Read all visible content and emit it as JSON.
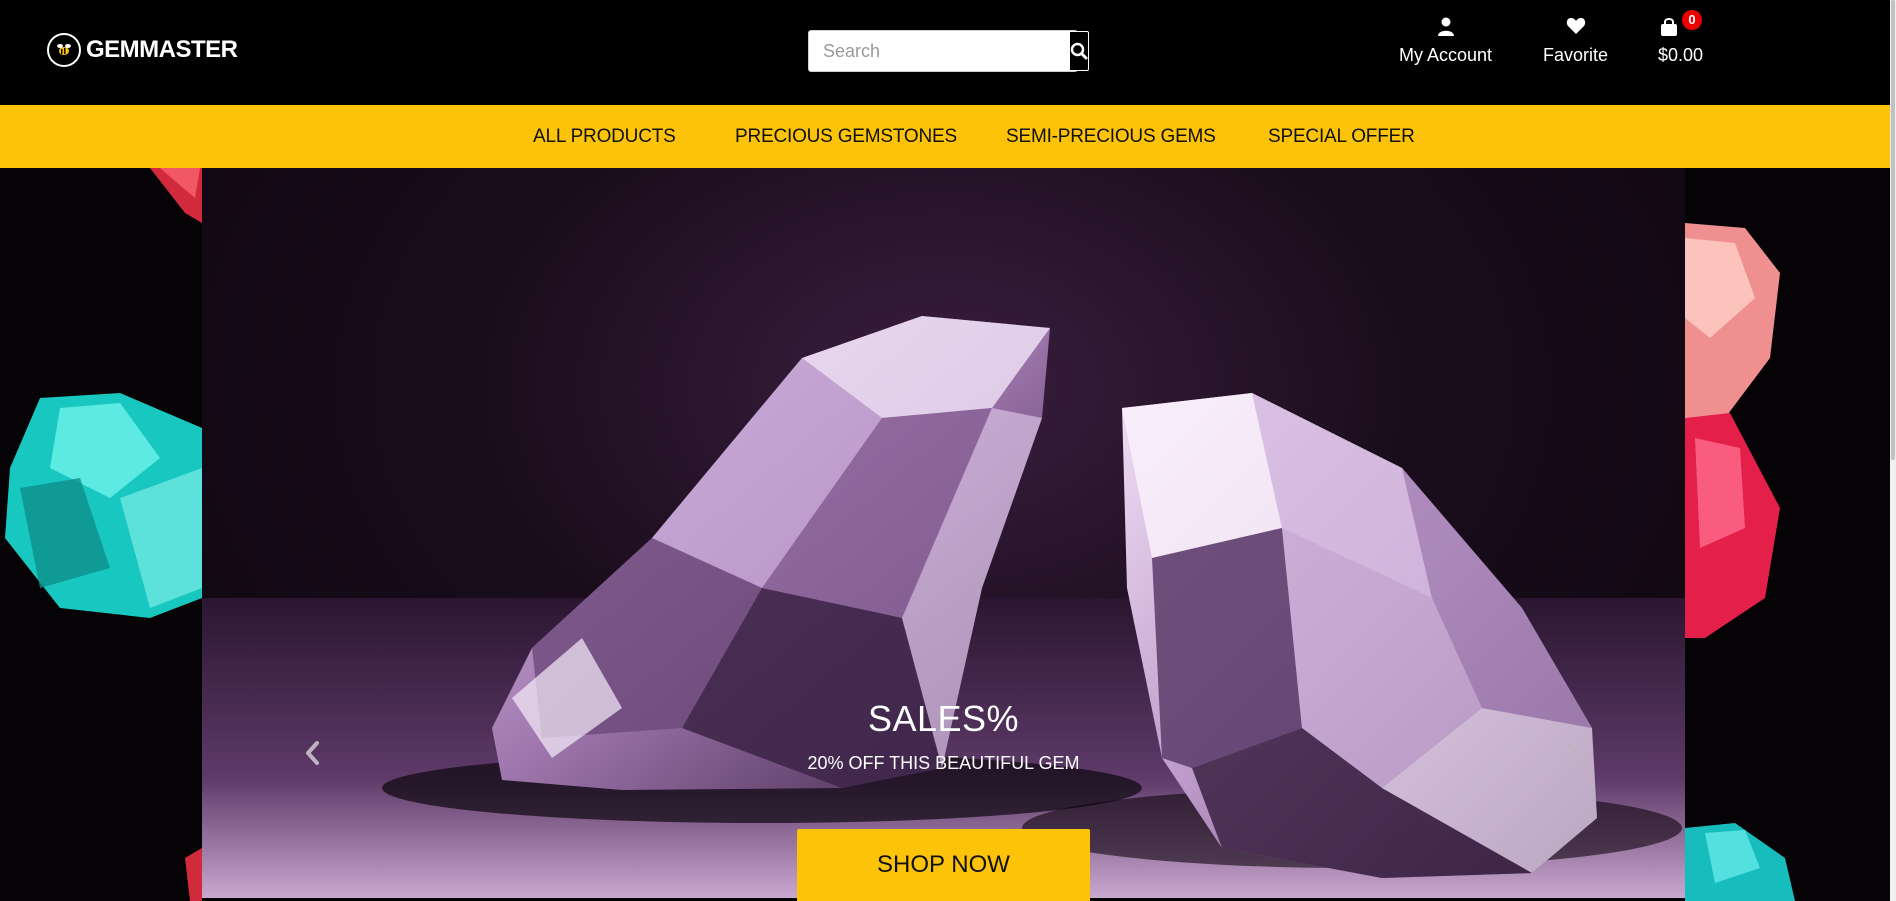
{
  "brand": {
    "name": "GEMMASTER"
  },
  "search": {
    "placeholder": "Search",
    "icon": "search-icon"
  },
  "header_items": {
    "account": {
      "label": "My Account",
      "icon": "user-icon"
    },
    "favorite": {
      "label": "Favorite",
      "icon": "heart-icon"
    },
    "cart": {
      "total": "$0.00",
      "count": "0",
      "icon": "shopping-bag-icon"
    }
  },
  "nav": {
    "items": [
      {
        "label": "ALL PRODUCTS"
      },
      {
        "label": "PRECIOUS GEMSTONES"
      },
      {
        "label": "SEMI-PRECIOUS GEMS"
      },
      {
        "label": "SPECIAL OFFER"
      }
    ]
  },
  "hero": {
    "title": "SALES%",
    "subtitle": "20% OFF THIS BEAUTIFUL GEM",
    "cta": "SHOP NOW",
    "prev_icon": "chevron-left-icon",
    "next_icon": "chevron-right-icon"
  },
  "colors": {
    "accent": "#fcc309",
    "header_bg": "#000000",
    "badge": "#e00000"
  }
}
